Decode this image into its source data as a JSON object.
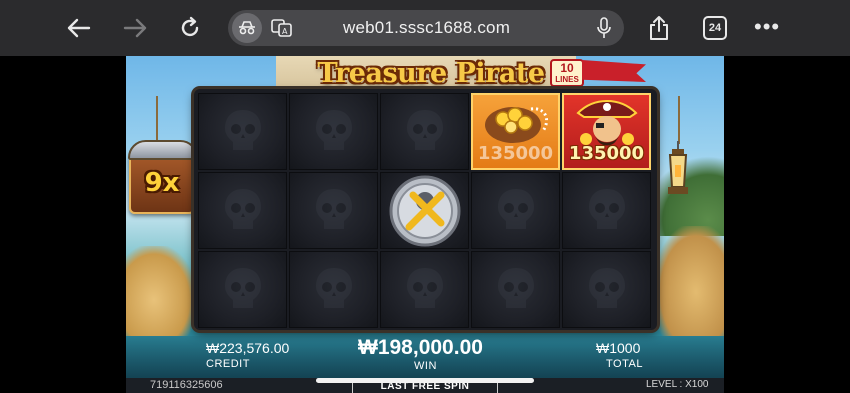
{
  "browser": {
    "url": "web01.sssc1688.com",
    "tab_count": "24",
    "icons": [
      "back-arrow-icon",
      "forward-arrow-icon",
      "reload-icon",
      "incognito-icon",
      "translate-icon",
      "microphone-icon",
      "share-icon",
      "tabs-icon",
      "more-icon"
    ]
  },
  "game": {
    "title": "Treasure Pirate",
    "lines_number": "10",
    "lines_label": "LINES",
    "multiplier": "9x",
    "grid": {
      "rows": 3,
      "cols": 5,
      "special_cells": [
        {
          "row": 0,
          "col": 3,
          "symbol": "treasure-chest",
          "prize": "135000",
          "highlighted": false
        },
        {
          "row": 0,
          "col": 4,
          "symbol": "pirate-captain",
          "prize": "135000",
          "highlighted": true
        },
        {
          "row": 1,
          "col": 2,
          "symbol": "silver-x-coin",
          "prize": "",
          "highlighted": false
        }
      ]
    },
    "hud": {
      "credit_value": "₩223,576.00",
      "credit_label": "CREDIT",
      "win_value": "₩198,000.00",
      "win_label": "WIN",
      "total_value": "₩1000",
      "total_label": "TOTAL"
    },
    "footer": {
      "session_id": "719116325606",
      "spin_button": "LAST FREE SPIN",
      "level": "LEVEL : X100"
    }
  },
  "colors": {
    "browser_bar": "#2b2b2d",
    "url_pill": "#48484b",
    "title_gold": "#f7c948",
    "gold_cell": "#f6a23a",
    "pirate_cell": "#e2342a"
  }
}
